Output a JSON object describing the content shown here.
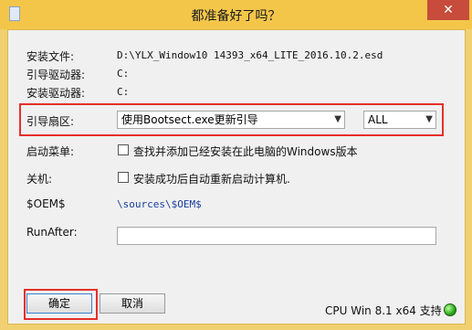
{
  "window": {
    "title": "都准备好了吗？",
    "close_glyph": "✕"
  },
  "fields": {
    "install_file_label": "安装文件:",
    "install_file_value": "D:\\YLX_Window10 14393_x64_LITE_2016.10.2.esd",
    "boot_drive_label": "引导驱动器:",
    "boot_drive_value": "C:",
    "install_drive_label": "安装驱动器:",
    "install_drive_value": "C:",
    "boot_sector_label": "引导扇区:",
    "boot_sector_selected": "使用Bootsect.exe更新引导",
    "boot_sector_scope_selected": "ALL",
    "boot_menu_label": "启动菜单:",
    "boot_menu_option": "查找并添加已经安装在此电脑的Windows版本",
    "shutdown_label": "关机:",
    "shutdown_option": "安装成功后自动重新启动计算机.",
    "oem_label": "$OEM$",
    "oem_value": "\\sources\\$OEM$",
    "run_after_label": "RunAfter:",
    "run_after_value": ""
  },
  "footer": {
    "ok_label": "确定",
    "cancel_label": "取消",
    "status_text": "CPU Win 8.1 x64 支持"
  },
  "icons": {
    "app": "app-icon",
    "close": "close-icon",
    "dropdown": "chevron-down-icon",
    "status": "status-led-icon"
  },
  "colors": {
    "title_bar": "#f3c64a",
    "close_button": "#c74c3c",
    "highlight": "#e4302a",
    "oem_text": "#1a3fa0",
    "status_led": "#2aa81a"
  }
}
